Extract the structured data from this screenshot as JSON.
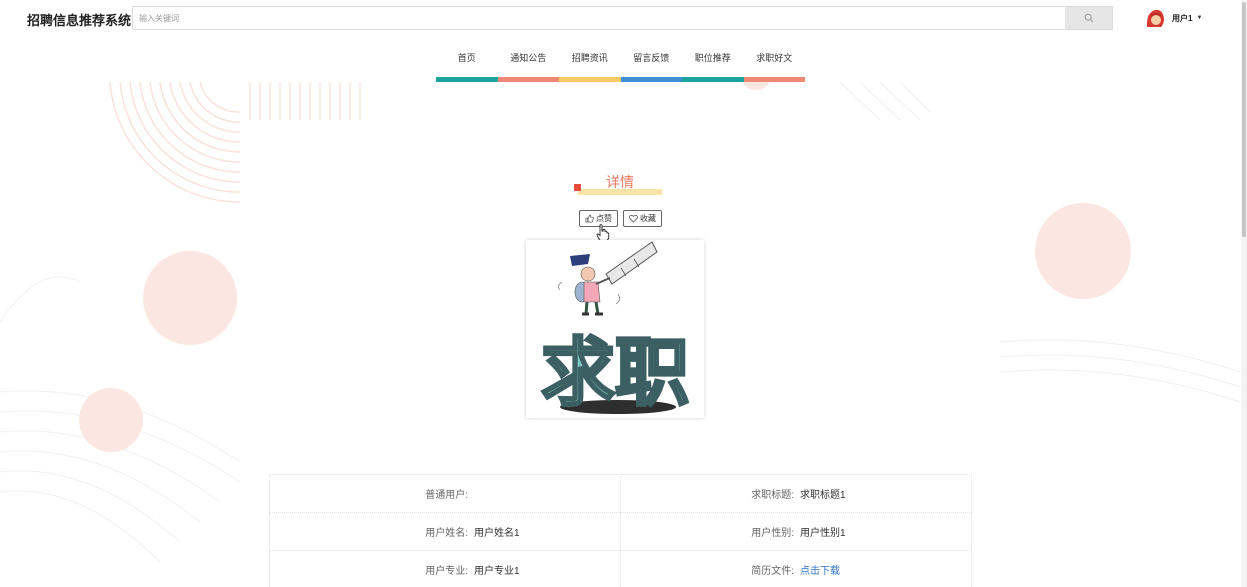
{
  "header": {
    "logo": "招聘信息推荐系统",
    "search_placeholder": "输入关键词",
    "username": "用户1"
  },
  "nav": [
    {
      "label": "首页",
      "color": "#1aa49a"
    },
    {
      "label": "通知公告",
      "color": "#f08a76"
    },
    {
      "label": "招聘资讯",
      "color": "#f6cb62"
    },
    {
      "label": "留言反馈",
      "color": "#3e8fd6"
    },
    {
      "label": "职位推荐",
      "color": "#1aa49a"
    },
    {
      "label": "求职好文",
      "color": "#f08a76"
    }
  ],
  "detail": {
    "title": "详情",
    "like_label": "点赞",
    "favorite_label": "收藏",
    "poster_text": "求职"
  },
  "info": {
    "row1": {
      "left_label": "普通用户:",
      "left_value": "",
      "right_label": "求职标题:",
      "right_value": "求职标题1"
    },
    "row2": {
      "left_label": "用户姓名:",
      "left_value": "用户姓名1",
      "right_label": "用户性别:",
      "right_value": "用户性别1"
    },
    "row3": {
      "left_label": "用户专业:",
      "left_value": "用户专业1",
      "right_label": "简历文件:",
      "right_value": "点击下载"
    }
  },
  "colors": {
    "accent": "#e8775d",
    "link": "#2f74c9"
  }
}
